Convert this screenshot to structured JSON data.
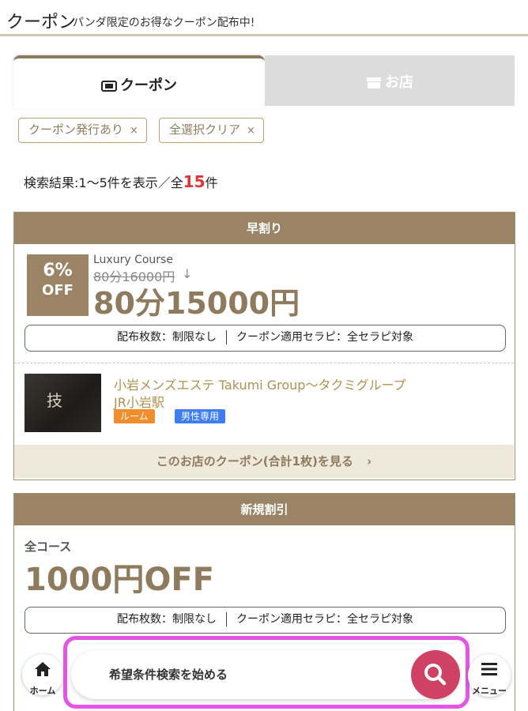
{
  "header": {
    "title": "クーポン",
    "subtitle": "パンダ限定のお得なクーポン配布中!"
  },
  "tabs": [
    {
      "label": "クーポン",
      "active": true,
      "icon": "ticket-icon"
    },
    {
      "label": "お店",
      "active": false,
      "icon": "shop-icon"
    }
  ],
  "filters": {
    "chips": [
      {
        "label": "クーポン発行あり",
        "close": "×"
      },
      {
        "label": "全選択クリア",
        "close": "×"
      }
    ]
  },
  "results": {
    "prefix": "検索結果:1〜5件を表示／全",
    "total": "15",
    "suffix": "件"
  },
  "coupons": [
    {
      "category": "早割り",
      "discount_pct": "6%",
      "discount_off": "OFF",
      "course_name": "Luxury Course",
      "old_price": "80分16000円",
      "arrow": "↓",
      "new_price": "80分15000円",
      "distribution_label": "配布枚数：制限なし",
      "therapist_label": "クーポン適用セラピ：全セラピ対象",
      "shop": {
        "name": "小岩メンズエステ Takumi Group〜タクミグループ",
        "station": "JR小岩駅",
        "thumb_text": "技",
        "tags": [
          "ルーム",
          "男性専用"
        ]
      },
      "shop_link": "このお店のクーポン(合計1枚)を見る",
      "shop_link_arrow": "›"
    },
    {
      "category": "新規割引",
      "course_name": "全コース",
      "new_price": "1000円OFF",
      "distribution_label": "配布枚数：制限なし",
      "therapist_label": "クーポン適用セラピ：全セラピ対象"
    }
  ],
  "bottom_nav": {
    "home_label": "ホーム",
    "search_text": "希望条件検索を始める",
    "menu_label": "メニュー"
  },
  "colors": {
    "accent": "#9a8465",
    "highlight": "#e455e6",
    "search_button": "#cf4263",
    "discount_red": "#e03434"
  }
}
